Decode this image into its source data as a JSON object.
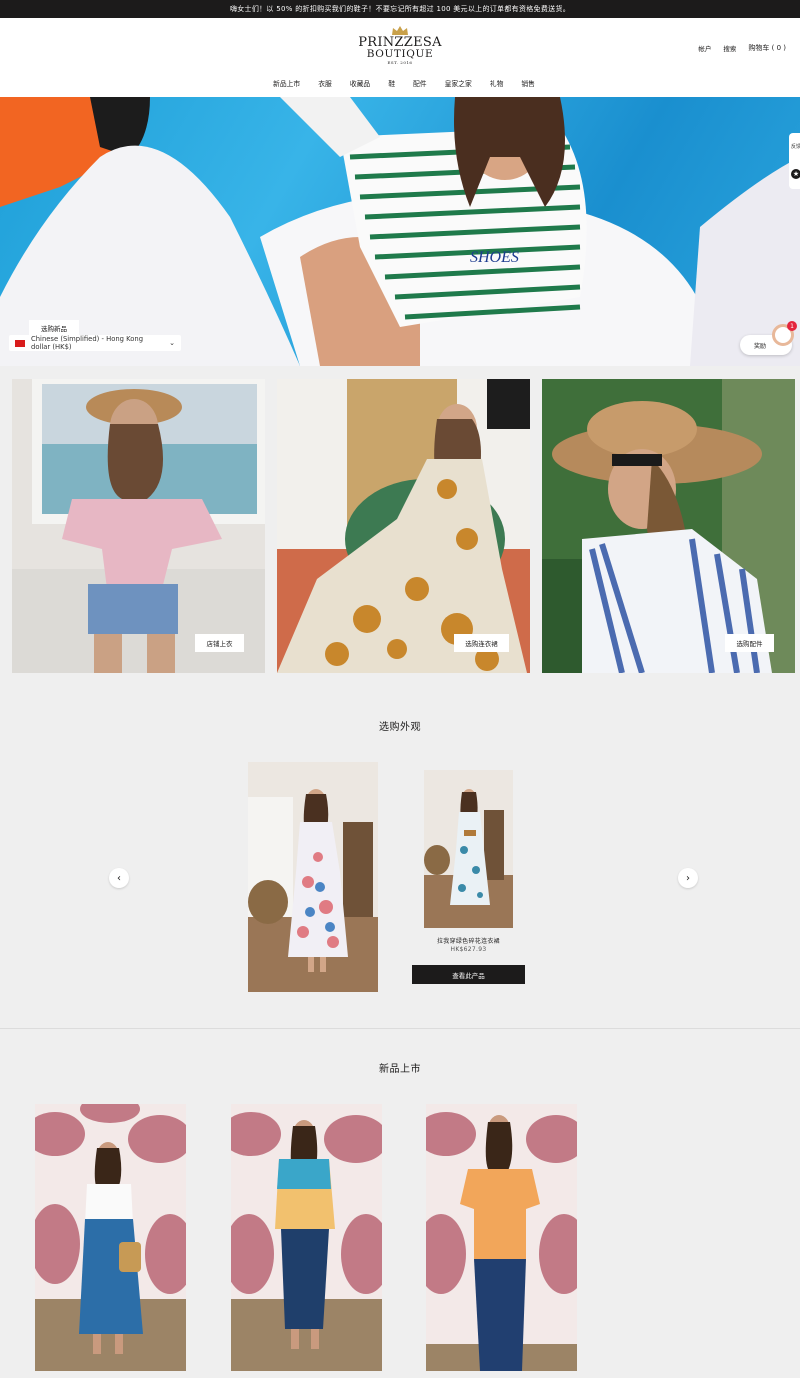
{
  "announcement": "嗨女士们！以 50% 的折扣购买我们的鞋子！不要忘记所有超过 100 美元以上的订单都有资格免费送货。",
  "logo": {
    "line1": "PRINZZESA",
    "line2": "BOUTIQUE",
    "line3": "EST. 2016"
  },
  "header_links": {
    "account": "帐户",
    "search": "搜索",
    "cart": "购物车 ( 0 )"
  },
  "nav": [
    "新品上市",
    "衣服",
    "收藏品",
    "鞋",
    "配件",
    "皇家之家",
    "礼物",
    "销售"
  ],
  "hero": {
    "button": "选购新品",
    "side_tab": "反馈"
  },
  "language_selector": "Chinese (Simplified) - Hong Kong dollar (HK$)",
  "reward": {
    "label": "奖励",
    "count": "1"
  },
  "categories": [
    {
      "button": "店铺上衣"
    },
    {
      "button": "选购连衣裙"
    },
    {
      "button": "选购配件"
    }
  ],
  "shop_look": {
    "title": "选购外观",
    "product_name": "拉我穿绿色碎花连衣裙",
    "price": "HK$627.93",
    "button": "查看此产品"
  },
  "new_arrivals": {
    "title": "新品上市"
  },
  "colors": {
    "announcement_bg": "#1c1b1b",
    "page_bg": "#efefef",
    "button_dark": "#1c1b1b",
    "badge": "#e4253d"
  },
  "icons": [
    "crown-icon",
    "chevron-down-icon",
    "chevron-left-icon",
    "chevron-right-icon",
    "star-icon",
    "flag-icon"
  ]
}
